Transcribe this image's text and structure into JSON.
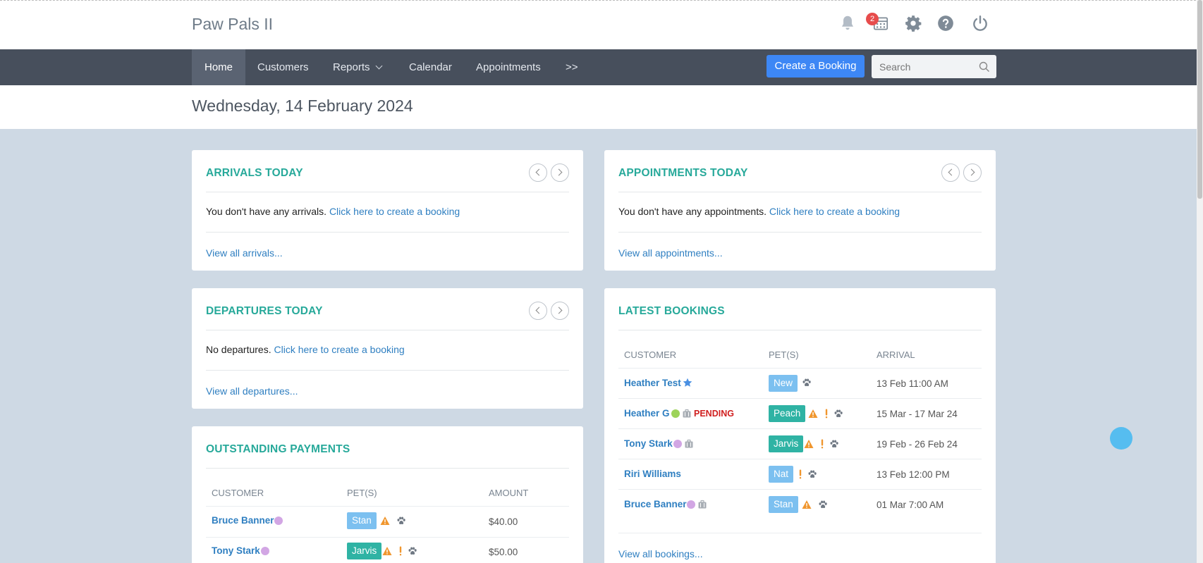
{
  "app": {
    "title": "Paw Pals II",
    "notification_count": "2"
  },
  "nav": {
    "items": [
      "Home",
      "Customers",
      "Reports",
      "Calendar",
      "Appointments",
      ">>"
    ],
    "create_booking": "Create a Booking",
    "search_placeholder": "Search"
  },
  "date": "Wednesday, 14 February 2024",
  "arrivals": {
    "title": "ARRIVALS TODAY",
    "empty_text": "You don't have any arrivals.",
    "create_link": "Click here to create a booking",
    "view_all": "View all arrivals..."
  },
  "appointments": {
    "title": "APPOINTMENTS TODAY",
    "empty_text": "You don't have any appointments.",
    "create_link": "Click here to create a booking",
    "view_all": "View all appointments..."
  },
  "departures": {
    "title": "DEPARTURES TODAY",
    "empty_text": "No departures.",
    "create_link": "Click here to create a booking",
    "view_all": "View all departures..."
  },
  "payments": {
    "title": "OUTSTANDING PAYMENTS",
    "columns": [
      "CUSTOMER",
      "PET(S)",
      "AMOUNT"
    ],
    "rows": [
      {
        "customer": "Bruce Banner",
        "pet": "Stan",
        "amount": "$40.00"
      },
      {
        "customer": "Tony Stark",
        "pet": "Jarvis",
        "amount": "$50.00"
      }
    ]
  },
  "latest": {
    "title": "LATEST BOOKINGS",
    "columns": [
      "CUSTOMER",
      "PET(S)",
      "ARRIVAL"
    ],
    "rows": [
      {
        "customer": "Heather Test",
        "pet": "New",
        "arrival": "13 Feb 11:00 AM"
      },
      {
        "customer": "Heather G",
        "status": "PENDING",
        "pet": "Peach",
        "arrival": "15 Mar - 17 Mar 24"
      },
      {
        "customer": "Tony Stark",
        "pet": "Jarvis",
        "arrival": "19 Feb - 26 Feb 24"
      },
      {
        "customer": "Riri Williams",
        "pet": "Nat",
        "arrival": "13 Feb 12:00 PM"
      },
      {
        "customer": "Bruce Banner",
        "pet": "Stan",
        "arrival": "01 Mar 7:00 AM"
      }
    ],
    "view_all": "View all bookings..."
  },
  "colors": {
    "accent": "#27a99a",
    "link": "#2f7fc1",
    "nav": "#474f5c",
    "primary": "#3d87f5"
  }
}
